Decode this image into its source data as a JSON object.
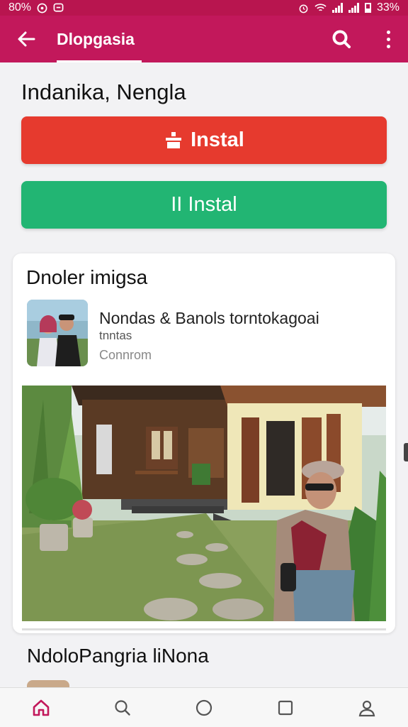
{
  "status_bar": {
    "time": "80% ",
    "battery_text": "33%",
    "icons": [
      "whatsapp-icon",
      "chat-icon",
      "alarm-icon",
      "wifi-icon",
      "signal-icon",
      "signal-icon",
      "battery-icon"
    ]
  },
  "app_bar": {
    "title": "Dlopgasia",
    "back_icon": "arrow-left-icon",
    "search_icon": "search-icon",
    "menu_icon": "more-vertical-icon",
    "color": "#c2185b"
  },
  "page": {
    "heading": "Indanika, Nengla"
  },
  "buttons": {
    "primary_label": "Instal",
    "primary_color": "#e63a2e",
    "secondary_label": "II Instal",
    "secondary_color": "#22b573"
  },
  "card": {
    "title": "Dnoler imigsa",
    "item": {
      "title": "Nondas & Banols torntokagoai",
      "subtitle": "tnntas",
      "meta": "Connrom"
    }
  },
  "section": {
    "title": "NdoloPangria liNona"
  },
  "bottom_nav": {
    "items": [
      {
        "name": "home-icon",
        "active": true
      },
      {
        "name": "search-icon",
        "active": false
      },
      {
        "name": "circle-icon",
        "active": false
      },
      {
        "name": "square-icon",
        "active": false
      },
      {
        "name": "profile-icon",
        "active": false
      }
    ],
    "active_color": "#c2185b"
  }
}
